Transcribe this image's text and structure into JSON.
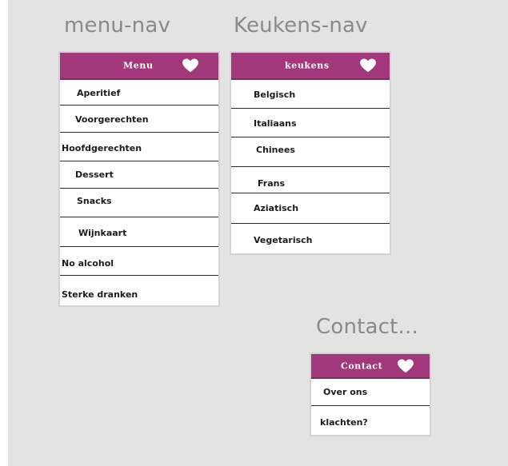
{
  "sections": {
    "menu_nav_title": "menu-nav",
    "keukens_nav_title": "Keukens-nav",
    "contact_title": "Contact..."
  },
  "menu_dropdown": {
    "header_label": "Menu",
    "header_icon": "heart-icon",
    "items": [
      "Aperitief",
      "Voorgerechten",
      "Hoofdgerechten",
      "Dessert",
      "Snacks",
      "Wijnkaart",
      "No alcohol",
      "Sterke dranken"
    ]
  },
  "keukens_dropdown": {
    "header_label": "keukens",
    "header_icon": "heart-icon",
    "items": [
      "Belgisch",
      "Italiaans",
      "Chinees",
      "Frans",
      "Aziatisch",
      "Vegetarisch"
    ]
  },
  "contact_dropdown": {
    "header_label": "Contact",
    "header_icon": "heart-icon",
    "items": [
      "Over ons",
      "klachten?"
    ]
  },
  "colors": {
    "header_background": "#a3377c",
    "canvas_background": "#e3e3e3",
    "title_text": "#8a8a8a",
    "item_text": "#1c1c1c"
  }
}
